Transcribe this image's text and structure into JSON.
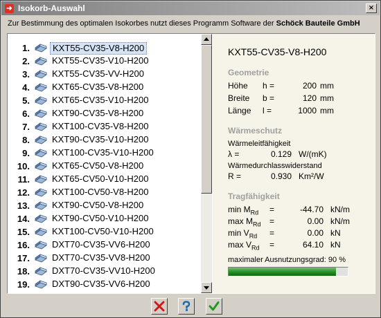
{
  "window": {
    "title": "Isokorb-Auswahl",
    "close_label": "×"
  },
  "info_text": "Zur Bestimmung des optimalen Isokorbes nutzt dieses Programm Software der ",
  "info_brand": "Schöck Bauteile GmbH",
  "list": {
    "selected_index": 0,
    "items": [
      {
        "num": "1.",
        "label": "KXT55-CV35-V8-H200"
      },
      {
        "num": "2.",
        "label": "KXT55-CV35-V10-H200"
      },
      {
        "num": "3.",
        "label": "KXT55-CV35-VV-H200"
      },
      {
        "num": "4.",
        "label": "KXT65-CV35-V8-H200"
      },
      {
        "num": "5.",
        "label": "KXT65-CV35-V10-H200"
      },
      {
        "num": "6.",
        "label": "KXT90-CV35-V8-H200"
      },
      {
        "num": "7.",
        "label": "KXT100-CV35-V8-H200"
      },
      {
        "num": "8.",
        "label": "KXT90-CV35-V10-H200"
      },
      {
        "num": "9.",
        "label": "KXT100-CV35-V10-H200"
      },
      {
        "num": "10.",
        "label": "KXT65-CV50-V8-H200"
      },
      {
        "num": "11.",
        "label": "KXT65-CV50-V10-H200"
      },
      {
        "num": "12.",
        "label": "KXT100-CV50-V8-H200"
      },
      {
        "num": "13.",
        "label": "KXT90-CV50-V8-H200"
      },
      {
        "num": "14.",
        "label": "KXT90-CV50-V10-H200"
      },
      {
        "num": "15.",
        "label": "KXT100-CV50-V10-H200"
      },
      {
        "num": "16.",
        "label": "DXT70-CV35-VV6-H200"
      },
      {
        "num": "17.",
        "label": "DXT70-CV35-VV8-H200"
      },
      {
        "num": "18.",
        "label": "DXT70-CV35-VV10-H200"
      },
      {
        "num": "19.",
        "label": "DXT90-CV35-VV6-H200"
      }
    ]
  },
  "detail": {
    "title": "KXT55-CV35-V8-H200",
    "geometry": {
      "heading": "Geometrie",
      "rows": [
        {
          "name": "Höhe",
          "sym": "h =",
          "value": "200",
          "unit": "mm"
        },
        {
          "name": "Breite",
          "sym": "b =",
          "value": "120",
          "unit": "mm"
        },
        {
          "name": "Länge",
          "sym": "l =",
          "value": "1000",
          "unit": "mm"
        }
      ]
    },
    "thermal": {
      "heading": "Wärmeschutz",
      "lambda_label": "Wärmeleitfähigkeit",
      "lambda_sym": "λ =",
      "lambda_value": "0.129",
      "lambda_unit": "W/(mK)",
      "r_label": "Wärmedurchlasswiderstand",
      "r_sym": "R =",
      "r_value": "0.930",
      "r_unit": "Km²/W"
    },
    "capacity": {
      "heading": "Tragfähigkeit",
      "rows": [
        {
          "name": "min M",
          "sub": "Rd",
          "sym": "=",
          "value": "-44.70",
          "unit": "kN/m"
        },
        {
          "name": "max M",
          "sub": "Rd",
          "sym": "=",
          "value": "0.00",
          "unit": "kN/m"
        },
        {
          "name": "min V",
          "sub": "Rd",
          "sym": "=",
          "value": "0.00",
          "unit": "kN"
        },
        {
          "name": "max V",
          "sub": "Rd",
          "sym": "=",
          "value": "64.10",
          "unit": "kN"
        }
      ],
      "utilization_label": "maximaler Ausnutzungsgrad: 90 %",
      "utilization_fraction": 0.9,
      "bar_color": "#1e8a1e"
    }
  },
  "buttons": [
    {
      "name": "cancel-button",
      "icon": "red-x-icon"
    },
    {
      "name": "help-button",
      "icon": "question-icon"
    },
    {
      "name": "ok-button",
      "icon": "green-check-icon"
    }
  ]
}
